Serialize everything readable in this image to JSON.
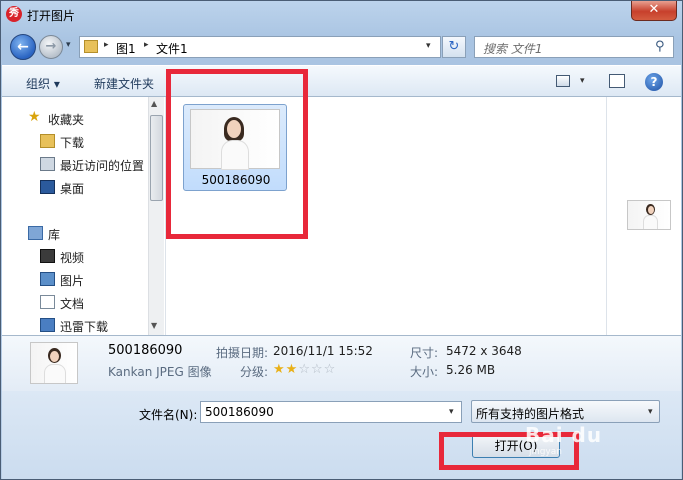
{
  "window": {
    "title": "打开图片",
    "app_icon": "秀",
    "close_glyph": "✕"
  },
  "nav": {
    "back_glyph": "←",
    "forward_glyph": "→",
    "history_glyph": "▾",
    "breadcrumb": [
      "图1",
      "文件1"
    ],
    "refresh_glyph": "↻",
    "search_placeholder": "搜索 文件1",
    "search_glyph": "⚲"
  },
  "toolbar": {
    "organize_label": "组织 ▾",
    "new_folder_label": "新建文件夹",
    "help_glyph": "?"
  },
  "sidebar": {
    "items": [
      {
        "label": "收藏夹",
        "icon": "star-icon"
      },
      {
        "label": "下载",
        "icon": "downloads-folder-icon"
      },
      {
        "label": "最近访问的位置",
        "icon": "recent-places-icon"
      },
      {
        "label": "桌面",
        "icon": "desktop-icon"
      },
      {
        "label": "库",
        "icon": "libraries-icon"
      },
      {
        "label": "视频",
        "icon": "videos-icon"
      },
      {
        "label": "图片",
        "icon": "pictures-icon"
      },
      {
        "label": "文档",
        "icon": "documents-icon"
      },
      {
        "label": "迅雷下载",
        "icon": "xunlei-download-icon"
      }
    ]
  },
  "files": [
    {
      "name": "500186090"
    }
  ],
  "details": {
    "name": "500186090",
    "type": "Kankan JPEG 图像",
    "date_label": "拍摄日期:",
    "date_value": "2016/11/1 15:52",
    "rating_label": "分级:",
    "rating_stars": 2,
    "rating_max": 5,
    "size_dims_label": "尺寸:",
    "size_dims_value": "5472 x 3648",
    "size_label": "大小:",
    "size_value": "5.26 MB"
  },
  "footer": {
    "filename_label": "文件名(N):",
    "filename_value": "500186090",
    "filetype_value": "所有支持的图片格式",
    "open_label": "打开(O)"
  },
  "watermark": {
    "text": "Bai du",
    "sub": "jingyan"
  },
  "colors": {
    "highlight_border": "#e8283a",
    "selection_fill": "#c1dcfc"
  }
}
